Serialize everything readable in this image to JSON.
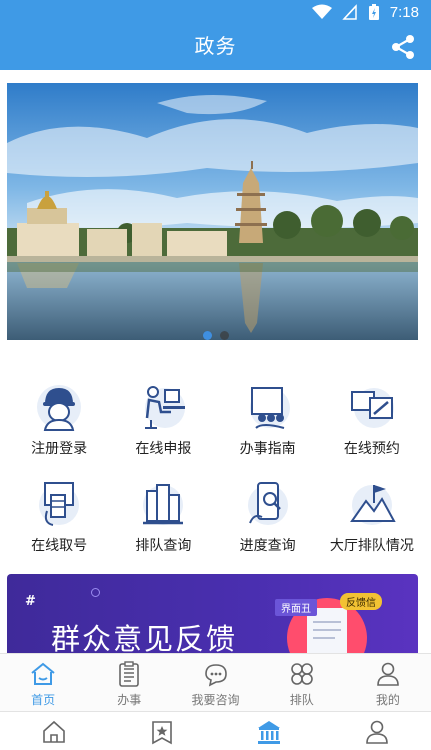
{
  "status_bar": {
    "time": "7:18"
  },
  "header": {
    "title": "政务"
  },
  "banner": {
    "slides": 2,
    "active_index": 0
  },
  "services": [
    {
      "label": "注册登录",
      "icon": "worker-helmet-icon"
    },
    {
      "label": "在线申报",
      "icon": "person-at-desk-icon"
    },
    {
      "label": "办事指南",
      "icon": "presentation-board-icon"
    },
    {
      "label": "在线预约",
      "icon": "calendar-pen-icon"
    },
    {
      "label": "在线取号",
      "icon": "ticket-machine-icon"
    },
    {
      "label": "排队查询",
      "icon": "people-queue-icon"
    },
    {
      "label": "进度查询",
      "icon": "phone-magnifier-icon"
    },
    {
      "label": "大厅排队情况",
      "icon": "flag-mountain-icon"
    }
  ],
  "promo": {
    "hash": "#",
    "headline": "群众意见反馈",
    "tag_left": "界面丑",
    "tag_right": "反馈信"
  },
  "tabs": [
    {
      "label": "首页",
      "icon": "home-icon",
      "active": true
    },
    {
      "label": "办事",
      "icon": "clipboard-icon",
      "active": false
    },
    {
      "label": "我要咨询",
      "icon": "chat-bubble-icon",
      "active": false
    },
    {
      "label": "排队",
      "icon": "clover-icon",
      "active": false
    },
    {
      "label": "我的",
      "icon": "user-icon",
      "active": false
    }
  ],
  "navbar": [
    {
      "icon": "home-outline-icon",
      "active": false
    },
    {
      "icon": "star-bookmark-icon",
      "active": false
    },
    {
      "icon": "government-building-icon",
      "active": true
    },
    {
      "icon": "person-outline-icon",
      "active": false
    }
  ],
  "colors": {
    "primary": "#3f9ae6",
    "promo_bg": "#4a2fb0",
    "text": "#222222"
  }
}
